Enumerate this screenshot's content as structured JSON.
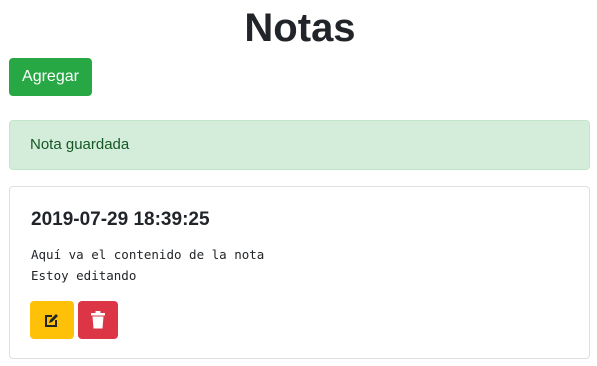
{
  "header": {
    "title": "Notas"
  },
  "toolbar": {
    "add_label": "Agregar"
  },
  "alert": {
    "message": "Nota guardada",
    "color": "#d4edda"
  },
  "note": {
    "date": "2019-07-29 18:39:25",
    "content_lines": [
      "Aquí va el contenido de la nota",
      "Estoy editando"
    ],
    "edit_icon": "edit-icon",
    "delete_icon": "trash-icon"
  },
  "colors": {
    "add_button": "#28a745",
    "edit_button": "#ffc107",
    "delete_button": "#dc3545"
  }
}
